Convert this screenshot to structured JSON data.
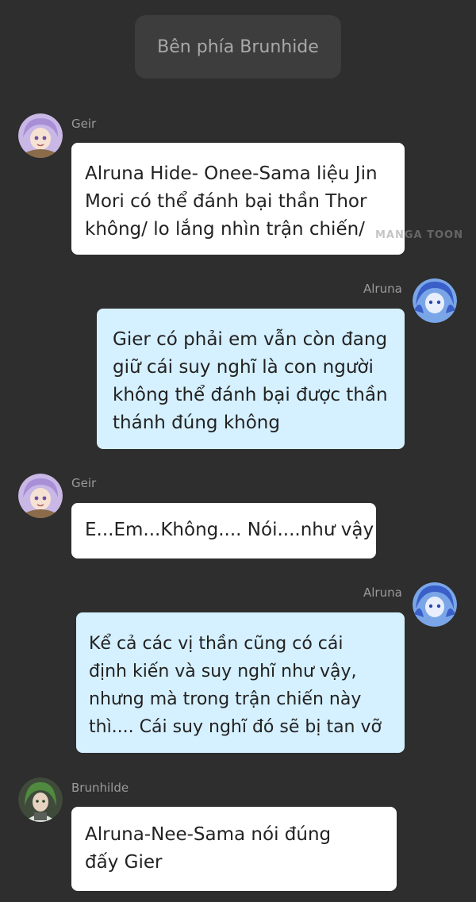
{
  "header": {
    "title": "Bên phía Brunhide"
  },
  "watermark": "MANGA TOON",
  "messages": [
    {
      "sender": "Geir",
      "side": "left",
      "avatar_icon": "girl-lavender-hair-avatar",
      "lines": [
        "Alruna Hide- Onee-Sama liệu Jin",
        "Mori có thể đánh bại thần Thor",
        "không/ lo lắng nhìn trận chiến/"
      ]
    },
    {
      "sender": "Alruna",
      "side": "right",
      "avatar_icon": "girl-blue-hair-avatar",
      "lines": [
        "Gier có phải em vẫn còn đang",
        "giữ cái suy nghĩ là con người",
        "không thể đánh bại được thần",
        "thánh đúng không"
      ]
    },
    {
      "sender": "Geir",
      "side": "left",
      "avatar_icon": "girl-lavender-hair-avatar",
      "lines": [
        "E...Em...Không.... Nói....như vậy"
      ]
    },
    {
      "sender": "Alruna",
      "side": "right",
      "avatar_icon": "girl-blue-hair-avatar",
      "lines": [
        "Kể cả các vị thần cũng có cái",
        "định kiến và suy nghĩ như vậy,",
        "nhưng mà trong trận chiến này",
        "thì.... Cái suy nghĩ đó sẽ bị tan vỡ"
      ]
    },
    {
      "sender": "Brunhilde",
      "side": "left",
      "avatar_icon": "woman-green-hair-avatar",
      "lines": [
        "Alruna-Nee-Sama nói đúng",
        "đấy Gier"
      ]
    }
  ],
  "colors": {
    "background": "#2e2e2e",
    "header_pill": "#3d3d3d",
    "left_bubble": "#ffffff",
    "right_bubble": "#d5f0ff",
    "name_text": "#9a9a9a"
  }
}
